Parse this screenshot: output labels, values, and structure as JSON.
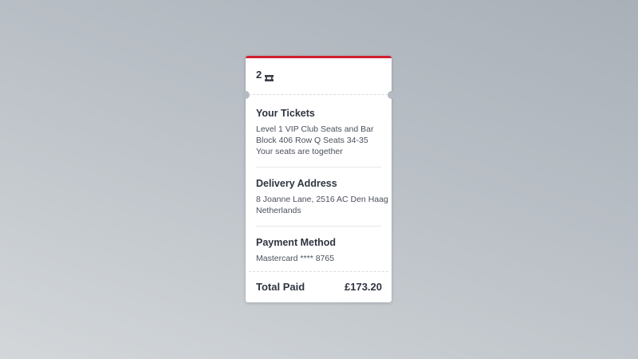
{
  "ticket": {
    "count": "2",
    "count_icon": "ticket-icon",
    "accent_color": "#cf1f2f"
  },
  "your_tickets": {
    "heading": "Your Tickets",
    "lines": [
      "Level 1 VIP Club Seats and Bar",
      "Block 406 Row Q Seats 34-35",
      "Your seats are together"
    ]
  },
  "delivery": {
    "heading": "Delivery Address",
    "lines": [
      "8 Joanne Lane, 2516 AC Den Haag",
      "Netherlands"
    ]
  },
  "payment": {
    "heading": "Payment Method",
    "lines": [
      "Mastercard **** 8765"
    ]
  },
  "total": {
    "label": "Total Paid",
    "amount": "£173.20"
  }
}
